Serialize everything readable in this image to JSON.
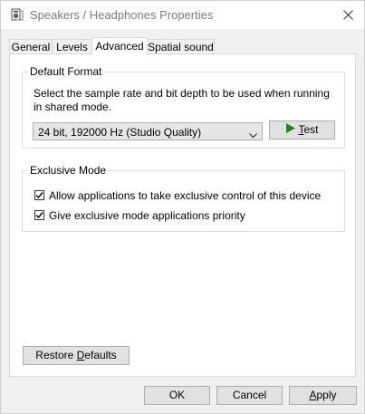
{
  "window": {
    "title": "Speakers / Headphones Properties",
    "title_icon": "speaker-icon",
    "close_icon": "close-icon"
  },
  "tabs": [
    {
      "label": "General"
    },
    {
      "label": "Levels"
    },
    {
      "label": "Advanced",
      "active": true
    },
    {
      "label": "Spatial sound"
    }
  ],
  "default_format": {
    "group_label": "Default Format",
    "description": "Select the sample rate and bit depth to be used when running in shared mode.",
    "selected_format": "24 bit, 192000 Hz (Studio Quality)",
    "test_label_prefix": "",
    "test_label_accel": "T",
    "test_label_rest": "est",
    "play_icon_color": "#1b8a1b"
  },
  "exclusive_mode": {
    "group_label": "Exclusive Mode",
    "allow_exclusive_label": "Allow applications to take exclusive control of this device",
    "allow_exclusive_checked": true,
    "priority_label": "Give exclusive mode applications priority",
    "priority_checked": true
  },
  "restore": {
    "prefix": "Restore ",
    "accel": "D",
    "rest": "efaults"
  },
  "footer": {
    "ok_label": "OK",
    "cancel_label": "Cancel",
    "apply_accel": "A",
    "apply_rest": "pply"
  }
}
